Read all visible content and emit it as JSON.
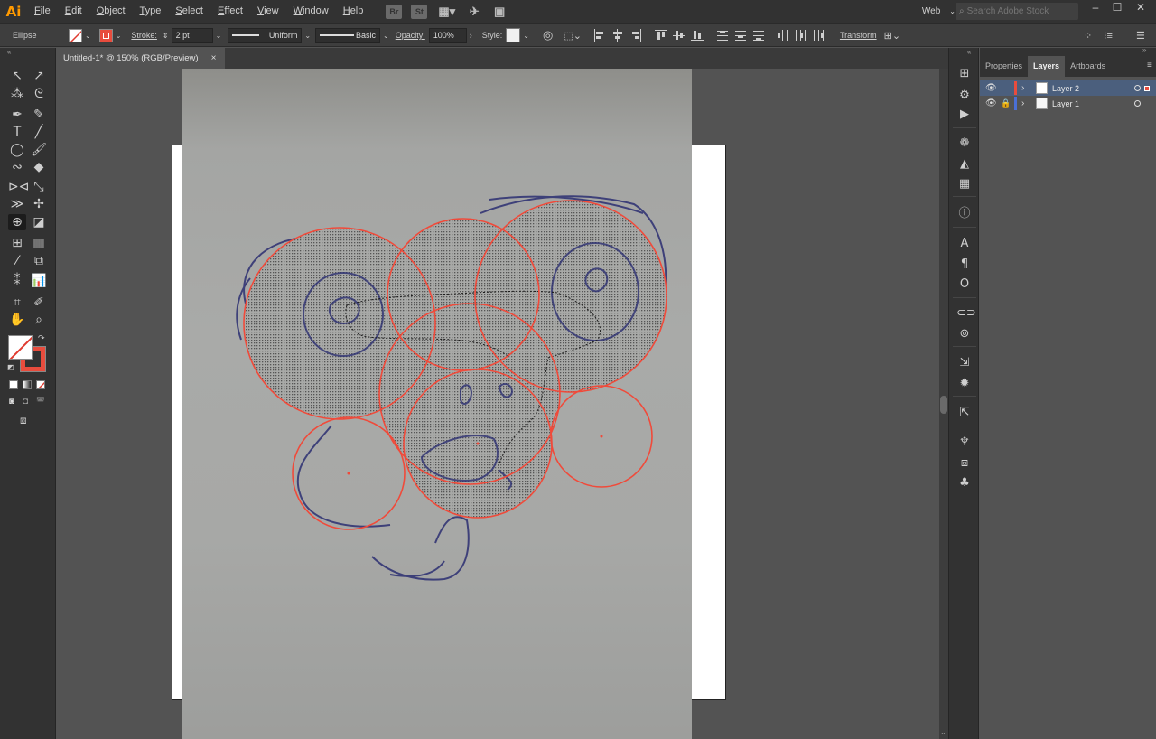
{
  "app": {
    "logo": "Ai",
    "menu": [
      "File",
      "Edit",
      "Object",
      "Type",
      "Select",
      "Effect",
      "View",
      "Window",
      "Help"
    ],
    "bridge_label": "Br",
    "stock_label": "St",
    "workspace_label": "Web",
    "search_placeholder": "Search Adobe Stock",
    "colors": {
      "accent": "#FF9A00",
      "selection": "#E84C3D",
      "layer2": "#E84C3D",
      "layer1": "#4A6FD6"
    }
  },
  "control_bar": {
    "object_type": "Ellipse",
    "stroke_label": "Stroke:",
    "stroke_weight": "2 pt",
    "profile_label": "Uniform",
    "brush_label": "Basic",
    "opacity_label": "Opacity:",
    "opacity_value": "100%",
    "style_label": "Style:",
    "transform_label": "Transform"
  },
  "document": {
    "tab_title": "Untitled-1* @ 150% (RGB/Preview)",
    "close_glyph": "×"
  },
  "panel": {
    "tabs": [
      "Properties",
      "Layers",
      "Artboards"
    ],
    "active_tab": "Layers",
    "layers": [
      {
        "name": "Layer 2",
        "selected": true,
        "locked": false
      },
      {
        "name": "Layer 1",
        "selected": false,
        "locked": true
      }
    ]
  },
  "icons": {
    "tools": [
      "selection-tool-icon",
      "direct-selection-tool-icon",
      "magic-wand-icon",
      "lasso-icon",
      "pen-icon",
      "curvature-icon",
      "type-icon",
      "line-icon",
      "ellipse-icon",
      "paintbrush-icon",
      "shaper-icon",
      "eraser-icon",
      "rotate-icon",
      "scale-icon",
      "width-icon",
      "puppet-warp-icon",
      "shape-builder-icon",
      "perspective-grid-icon",
      "mesh-icon",
      "gradient-icon",
      "eyedropper-icon",
      "blend-icon",
      "symbol-sprayer-icon",
      "column-graph-icon",
      "artboard-icon",
      "slice-icon",
      "hand-icon",
      "zoom-icon"
    ]
  }
}
